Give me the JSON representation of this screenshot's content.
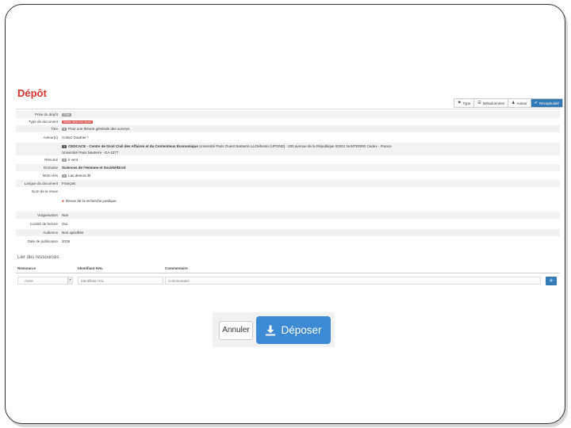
{
  "title": "Dépôt",
  "toolbar": [
    {
      "icon": "tag-icon",
      "label": "Type"
    },
    {
      "icon": "list-icon",
      "label": "Métadonnées"
    },
    {
      "icon": "user-icon",
      "label": "Auteur"
    },
    {
      "icon": "check-icon",
      "label": "Récapitulatif"
    }
  ],
  "fields": [
    {
      "label": "Prise du dépôt",
      "badge": "Grille",
      "value": ""
    },
    {
      "label": "Type de document",
      "badge": "Article dans une revue",
      "value": ""
    },
    {
      "label": "Titre",
      "badge": "fr",
      "value": "Pour une théorie générale des surveys"
    },
    {
      "label": "Auteur(s)",
      "value": "Cortez Gautrier *"
    },
    {
      "label": "",
      "badge": "1",
      "value": "CEDCACE - Centre de Droit Civil des Affaires et du Contentieux Économique",
      "extra": "Université Paris Ouest Nanterre La Défense (UPOND) : 200 avenue de la République 92001 NANTERRE Cedex - France"
    },
    {
      "label": "",
      "value": "Université Paris Nanterre - EA 4377"
    },
    {
      "label": "Résumé",
      "badge": "fr",
      "value": "ti vent"
    },
    {
      "label": "Domaine",
      "value": "Sciences de l'Homme et Société/Droit"
    },
    {
      "label": "Mots-clés",
      "badge": "fr",
      "value": "Las demos dit"
    },
    {
      "label": "Langue du document",
      "value": "Français"
    },
    {
      "label": "Nom de la revue",
      "value": ""
    },
    {
      "label": "",
      "value": "Revue de la recherche juridique"
    },
    {
      "label": "Vulgarisation",
      "value": "Non"
    },
    {
      "label": "Comité de lecture",
      "value": "Oui"
    },
    {
      "label": "Audience",
      "value": "Non spécifiée"
    },
    {
      "label": "Date de publication",
      "value": "2019"
    }
  ],
  "resources": {
    "heading": "Lier des ressources",
    "col_resource": "Ressource",
    "col_id": "Identifiant HAL",
    "col_comment": "Commentaire",
    "select_value": "Autre",
    "id_placeholder": "Identifiant HAL",
    "comment_placeholder": "Commentaire",
    "add_label": "+"
  },
  "buttons": {
    "cancel": "Annuler",
    "deposit": "Déposer"
  },
  "colors": {
    "title": "#d9342b",
    "primary": "#3c8ad4",
    "badge_red": "#d9534f"
  }
}
